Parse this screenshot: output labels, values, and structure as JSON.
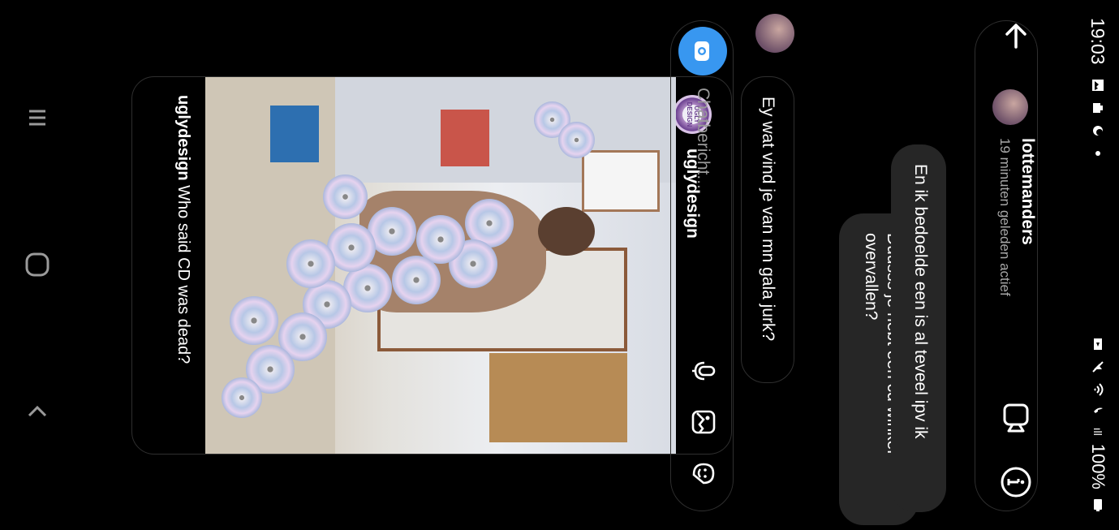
{
  "status_bar": {
    "time": "19:03",
    "battery": "100%",
    "signal_label": "ıll"
  },
  "header": {
    "username": "lottemanders",
    "activity": "19 minuten geleden actief"
  },
  "shared_post": {
    "account": "uglydesign",
    "avatar_text": "UGLY DESIGN",
    "caption": "Who said CD was dead?"
  },
  "messages": {
    "incoming": "Ey wat vind je van mn gala jurk?",
    "outgoing_1": "Duusss je hebt een cd winkel overvallen?",
    "outgoing_2": "En ik bedoelde een is al teveel ipv ik"
  },
  "composer": {
    "placeholder": "Chatbericht..."
  },
  "colors": {
    "accent_camera": "#3897f0",
    "bubble_out": "#262626",
    "background": "#000000"
  },
  "icons": [
    "back-arrow-icon",
    "video-call-icon",
    "info-icon",
    "camera-icon",
    "microphone-icon",
    "gallery-icon",
    "sticker-icon",
    "recents-icon",
    "home-icon",
    "back-nav-icon"
  ]
}
